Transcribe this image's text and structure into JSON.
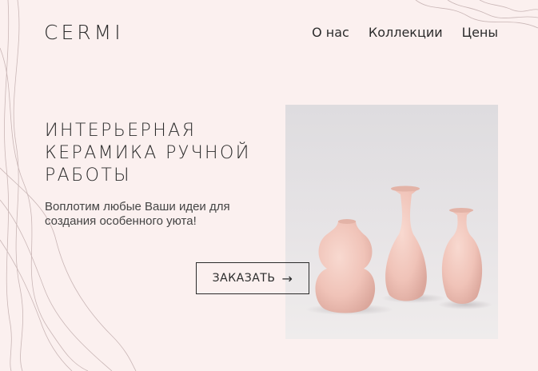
{
  "brand": {
    "logo": "CERMI"
  },
  "nav": {
    "items": [
      "О нас",
      "Коллекции",
      "Цены"
    ]
  },
  "hero": {
    "title_lines": [
      "Интерьерная",
      "керамика ручной",
      "работы"
    ],
    "subtitle": "Воплотим любые Ваши идеи для создания особенного уюта!",
    "cta_label": "ЗАКАЗАТЬ",
    "cta_arrow": "→"
  },
  "colors": {
    "background": "#fbf0ef",
    "text": "#2b2b2b",
    "vase": "#f3c9be"
  },
  "image": {
    "subject": "three pink ceramic vases"
  }
}
